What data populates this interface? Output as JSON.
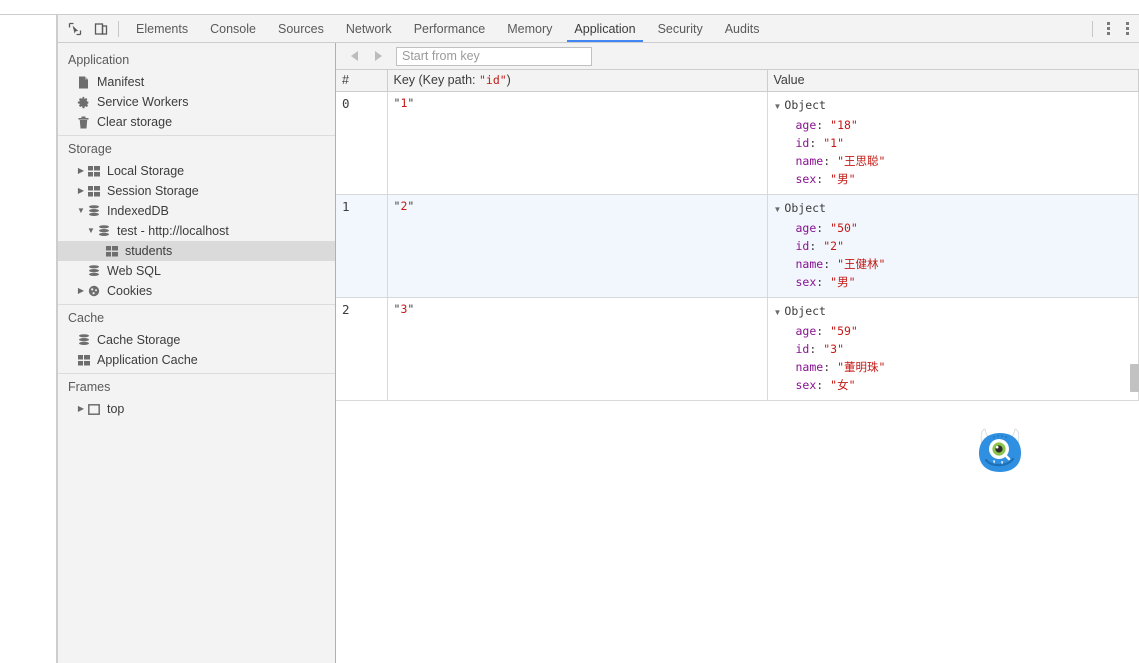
{
  "toolbar": {
    "inspect_icon": "inspect-cursor-icon",
    "device_icon": "device-toolbar-icon",
    "menu_icon": "more-options-icon",
    "tabs": [
      {
        "label": "Elements",
        "active": false
      },
      {
        "label": "Console",
        "active": false
      },
      {
        "label": "Sources",
        "active": false
      },
      {
        "label": "Network",
        "active": false
      },
      {
        "label": "Performance",
        "active": false
      },
      {
        "label": "Memory",
        "active": false
      },
      {
        "label": "Application",
        "active": true
      },
      {
        "label": "Security",
        "active": false
      },
      {
        "label": "Audits",
        "active": false
      }
    ],
    "accent_color": "#4285f4"
  },
  "sidebar": {
    "sections": [
      {
        "title": "Application",
        "items": [
          {
            "label": "Manifest",
            "icon": "document-icon",
            "indent": 1,
            "arrow": "none",
            "selected": false
          },
          {
            "label": "Service Workers",
            "icon": "gear-icon",
            "indent": 1,
            "arrow": "none",
            "selected": false
          },
          {
            "label": "Clear storage",
            "icon": "trash-icon",
            "indent": 1,
            "arrow": "none",
            "selected": false
          }
        ]
      },
      {
        "title": "Storage",
        "items": [
          {
            "label": "Local Storage",
            "icon": "table-icon",
            "indent": 1,
            "arrow": "collapsed",
            "selected": false
          },
          {
            "label": "Session Storage",
            "icon": "table-icon",
            "indent": 1,
            "arrow": "collapsed",
            "selected": false
          },
          {
            "label": "IndexedDB",
            "icon": "database-icon",
            "indent": 1,
            "arrow": "expanded",
            "selected": false
          },
          {
            "label": "test - http://localhost",
            "icon": "database-icon",
            "indent": 2,
            "arrow": "expanded",
            "selected": false
          },
          {
            "label": "students",
            "icon": "table-icon",
            "indent": 3,
            "arrow": "none",
            "selected": true
          },
          {
            "label": "Web SQL",
            "icon": "database-icon",
            "indent": 1,
            "arrow": "none",
            "selected": false
          },
          {
            "label": "Cookies",
            "icon": "cookie-icon",
            "indent": 1,
            "arrow": "collapsed",
            "selected": false
          }
        ]
      },
      {
        "title": "Cache",
        "items": [
          {
            "label": "Cache Storage",
            "icon": "database-icon",
            "indent": 1,
            "arrow": "none",
            "selected": false
          },
          {
            "label": "Application Cache",
            "icon": "table-icon",
            "indent": 1,
            "arrow": "none",
            "selected": false
          }
        ]
      },
      {
        "title": "Frames",
        "items": [
          {
            "label": "top",
            "icon": "frame-icon",
            "indent": 1,
            "arrow": "collapsed",
            "selected": false
          }
        ]
      }
    ]
  },
  "main": {
    "nav": {
      "prev_icon": "arrow-left-icon",
      "next_icon": "arrow-right-icon",
      "prev_enabled": false,
      "next_enabled": false
    },
    "search": {
      "placeholder": "Start from key",
      "value": ""
    },
    "table": {
      "columns": [
        "#",
        "Key (Key path: \"id\")",
        "Value"
      ],
      "key_path_prefix": "Key (Key path: ",
      "key_path_name": "\"id\"",
      "key_path_suffix": ")",
      "object_label": "Object",
      "rows": [
        {
          "index": "0",
          "key": "\"1\"",
          "key_raw": "1",
          "props": [
            {
              "name": "age",
              "value": "\"18\""
            },
            {
              "name": "id",
              "value": "\"1\""
            },
            {
              "name": "name",
              "value": "\"王思聪\""
            },
            {
              "name": "sex",
              "value": "\"男\""
            }
          ]
        },
        {
          "index": "1",
          "key": "\"2\"",
          "key_raw": "2",
          "props": [
            {
              "name": "age",
              "value": "\"50\""
            },
            {
              "name": "id",
              "value": "\"2\""
            },
            {
              "name": "name",
              "value": "\"王健林\""
            },
            {
              "name": "sex",
              "value": "\"男\""
            }
          ]
        },
        {
          "index": "2",
          "key": "\"3\"",
          "key_raw": "3",
          "props": [
            {
              "name": "age",
              "value": "\"59\""
            },
            {
              "name": "id",
              "value": "\"3\""
            },
            {
              "name": "name",
              "value": "\"董明珠\""
            },
            {
              "name": "sex",
              "value": "\"女\""
            }
          ]
        }
      ]
    },
    "watermark": {
      "icon": "monster-magnifier-logo"
    }
  },
  "colors": {
    "string_value": "#c41a16",
    "property_name": "#881391",
    "selected_row_bg": "#f2f7fd",
    "selection_bg": "#dadada",
    "chrome_bg": "#f3f3f3",
    "monster_blue": "#2f8fe0"
  }
}
